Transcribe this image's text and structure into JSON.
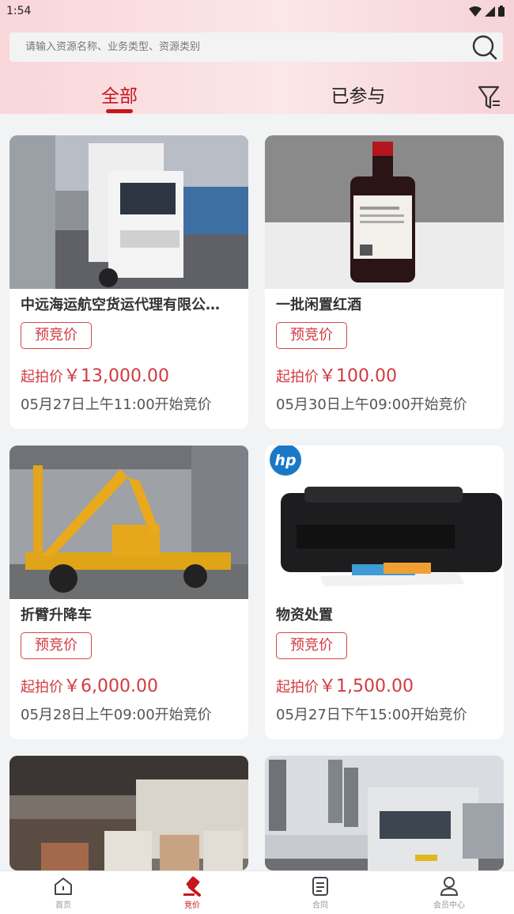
{
  "status_bar": {
    "time": "1:54"
  },
  "search": {
    "placeholder": "请输入资源名称、业务类型、资源类别"
  },
  "tabs": [
    {
      "label": "全部",
      "active": true
    },
    {
      "label": "已参与",
      "active": false
    }
  ],
  "cards": [
    {
      "title": "中远海运航空货运代理有限公…",
      "badge": "预竞价",
      "price_label": "起拍价",
      "price": "￥13,000.00",
      "time": "05月27日上午11:00开始竞价",
      "image": "white truck"
    },
    {
      "title": "一批闲置红酒",
      "badge": "预竞价",
      "price_label": "起拍价",
      "price": "￥100.00",
      "time": "05月30日上午09:00开始竞价",
      "image": "red wine bottle"
    },
    {
      "title": "折臂升降车",
      "badge": "预竞价",
      "price_label": "起拍价",
      "price": "￥6,000.00",
      "time": "05月28日上午09:00开始竞价",
      "image": "yellow lift truck"
    },
    {
      "title": "物资处置",
      "badge": "预竞价",
      "price_label": "起拍价",
      "price": "￥1,500.00",
      "time": "05月27日下午15:00开始竞价",
      "image": "hp printer",
      "image_text": "hp"
    }
  ],
  "bottom_nav": [
    {
      "label": "首页",
      "icon": "home-icon",
      "active": false
    },
    {
      "label": "竞价",
      "icon": "gavel-icon",
      "active": true
    },
    {
      "label": "合同",
      "icon": "document-icon",
      "active": false
    },
    {
      "label": "会员中心",
      "icon": "user-icon",
      "active": false
    }
  ],
  "colors": {
    "accent": "#c8161d",
    "price": "#d23a41",
    "background": "#f2f3f5"
  }
}
